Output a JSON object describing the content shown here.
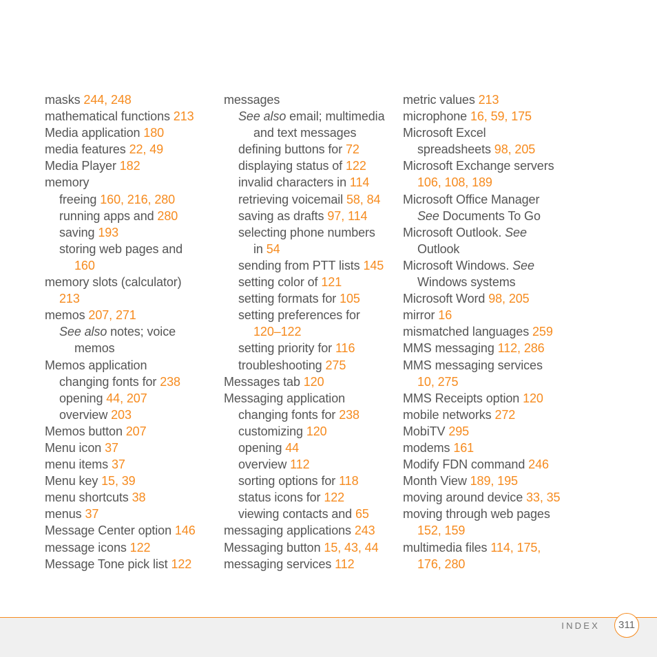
{
  "document": {
    "section_label": "INDEX",
    "page_number": "311",
    "colors": {
      "accent": "#f68b1f",
      "text": "#555555",
      "footer_bg": "#f0f0f0"
    }
  },
  "columns": [
    {
      "entries": [
        {
          "level": 0,
          "text": "masks ",
          "pages": "244, 248"
        },
        {
          "level": 0,
          "text": "mathematical functions ",
          "pages": "213"
        },
        {
          "level": 0,
          "text": "Media application ",
          "pages": "180"
        },
        {
          "level": 0,
          "text": "media features ",
          "pages": "22, 49"
        },
        {
          "level": 0,
          "text": "Media Player ",
          "pages": "182"
        },
        {
          "level": 0,
          "text": "memory",
          "pages": ""
        },
        {
          "level": 1,
          "text": "freeing ",
          "pages": "160, 216, 280"
        },
        {
          "level": 1,
          "text": "running apps and ",
          "pages": "280"
        },
        {
          "level": 1,
          "text": "saving ",
          "pages": "193"
        },
        {
          "level": 1,
          "text": "storing web pages and",
          "pages": ""
        },
        {
          "level": 2,
          "text": "",
          "pages": "160"
        },
        {
          "level": 0,
          "text": "memory slots (calculator)",
          "pages": ""
        },
        {
          "level": 1,
          "text": "",
          "pages": "213"
        },
        {
          "level": 0,
          "text": "memos ",
          "pages": "207, 271"
        },
        {
          "level": 1,
          "italic": "See also",
          "text": " notes; voice",
          "pages": ""
        },
        {
          "level": 2,
          "text": "memos",
          "pages": ""
        },
        {
          "level": 0,
          "text": "Memos application",
          "pages": ""
        },
        {
          "level": 1,
          "text": "changing fonts for ",
          "pages": "238"
        },
        {
          "level": 1,
          "text": "opening ",
          "pages": "44, 207"
        },
        {
          "level": 1,
          "text": "overview ",
          "pages": "203"
        },
        {
          "level": 0,
          "text": "Memos button ",
          "pages": "207"
        },
        {
          "level": 0,
          "text": "Menu icon ",
          "pages": "37"
        },
        {
          "level": 0,
          "text": "menu items ",
          "pages": "37"
        },
        {
          "level": 0,
          "text": "Menu key ",
          "pages": "15, 39"
        },
        {
          "level": 0,
          "text": "menu shortcuts ",
          "pages": "38"
        },
        {
          "level": 0,
          "text": "menus ",
          "pages": "37"
        },
        {
          "level": 0,
          "text": "Message Center option ",
          "pages": "146"
        },
        {
          "level": 0,
          "text": "message icons ",
          "pages": "122"
        },
        {
          "level": 0,
          "text": "Message Tone pick list ",
          "pages": "122"
        }
      ]
    },
    {
      "entries": [
        {
          "level": 0,
          "text": "messages",
          "pages": ""
        },
        {
          "level": 1,
          "italic": "See also",
          "text": " email; multimedia",
          "pages": ""
        },
        {
          "level": 2,
          "text": "and text messages",
          "pages": ""
        },
        {
          "level": 1,
          "text": "defining buttons for ",
          "pages": "72"
        },
        {
          "level": 1,
          "text": "displaying status of ",
          "pages": "122"
        },
        {
          "level": 1,
          "text": "invalid characters in ",
          "pages": "114"
        },
        {
          "level": 1,
          "text": "retrieving voicemail ",
          "pages": "58, 84"
        },
        {
          "level": 1,
          "text": "saving as drafts ",
          "pages": "97, 114"
        },
        {
          "level": 1,
          "text": "selecting phone numbers",
          "pages": ""
        },
        {
          "level": 2,
          "text": "in ",
          "pages": "54"
        },
        {
          "level": 1,
          "text": "sending from PTT lists ",
          "pages": "145"
        },
        {
          "level": 1,
          "text": "setting color of ",
          "pages": "121"
        },
        {
          "level": 1,
          "text": "setting formats for ",
          "pages": "105"
        },
        {
          "level": 1,
          "text": "setting preferences for",
          "pages": ""
        },
        {
          "level": 2,
          "text": "",
          "pages": "120–122"
        },
        {
          "level": 1,
          "text": "setting priority for ",
          "pages": "116"
        },
        {
          "level": 1,
          "text": "troubleshooting ",
          "pages": "275"
        },
        {
          "level": 0,
          "text": "Messages tab ",
          "pages": "120"
        },
        {
          "level": 0,
          "text": "Messaging application",
          "pages": ""
        },
        {
          "level": 1,
          "text": "changing fonts for ",
          "pages": "238"
        },
        {
          "level": 1,
          "text": "customizing ",
          "pages": "120"
        },
        {
          "level": 1,
          "text": "opening ",
          "pages": "44"
        },
        {
          "level": 1,
          "text": "overview ",
          "pages": "112"
        },
        {
          "level": 1,
          "text": "sorting options for ",
          "pages": "118"
        },
        {
          "level": 1,
          "text": "status icons for ",
          "pages": "122"
        },
        {
          "level": 1,
          "text": "viewing contacts and ",
          "pages": "65"
        },
        {
          "level": 0,
          "text": "messaging applications ",
          "pages": "243"
        },
        {
          "level": 0,
          "text": "Messaging button ",
          "pages": "15, 43, 44"
        },
        {
          "level": 0,
          "text": "messaging services ",
          "pages": "112"
        }
      ]
    },
    {
      "entries": [
        {
          "level": 0,
          "text": "metric values ",
          "pages": "213"
        },
        {
          "level": 0,
          "text": "microphone ",
          "pages": "16, 59, 175"
        },
        {
          "level": 0,
          "text": "Microsoft Excel",
          "pages": ""
        },
        {
          "level": 1,
          "text": "spreadsheets ",
          "pages": "98, 205"
        },
        {
          "level": 0,
          "text": "Microsoft Exchange servers",
          "pages": ""
        },
        {
          "level": 1,
          "text": "",
          "pages": "106, 108, 189"
        },
        {
          "level": 0,
          "text": "Microsoft Office Manager",
          "pages": ""
        },
        {
          "level": 1,
          "italic": "See",
          "text": " Documents To Go",
          "pages": ""
        },
        {
          "level": 0,
          "text": "Microsoft Outlook. ",
          "italic_after": "See",
          "pages": ""
        },
        {
          "level": 1,
          "text": "Outlook",
          "pages": ""
        },
        {
          "level": 0,
          "text": "Microsoft Windows. ",
          "italic_after": "See",
          "pages": ""
        },
        {
          "level": 1,
          "text": "Windows systems",
          "pages": ""
        },
        {
          "level": 0,
          "text": "Microsoft Word ",
          "pages": "98, 205"
        },
        {
          "level": 0,
          "text": "mirror ",
          "pages": "16"
        },
        {
          "level": 0,
          "text": "mismatched languages ",
          "pages": "259"
        },
        {
          "level": 0,
          "text": "MMS messaging ",
          "pages": "112, 286"
        },
        {
          "level": 0,
          "text": "MMS messaging services",
          "pages": ""
        },
        {
          "level": 1,
          "text": "",
          "pages": "10, 275"
        },
        {
          "level": 0,
          "text": "MMS Receipts option ",
          "pages": "120"
        },
        {
          "level": 0,
          "text": "mobile networks ",
          "pages": "272"
        },
        {
          "level": 0,
          "text": "MobiTV ",
          "pages": "295"
        },
        {
          "level": 0,
          "text": "modems ",
          "pages": "161"
        },
        {
          "level": 0,
          "text": "Modify FDN command ",
          "pages": "246"
        },
        {
          "level": 0,
          "text": "Month View ",
          "pages": "189, 195"
        },
        {
          "level": 0,
          "text": "moving around device ",
          "pages": "33, 35"
        },
        {
          "level": 0,
          "text": "moving through web pages",
          "pages": ""
        },
        {
          "level": 1,
          "text": "",
          "pages": "152, 159"
        },
        {
          "level": 0,
          "text": "multimedia files ",
          "pages": "114, 175,"
        },
        {
          "level": 1,
          "text": "",
          "pages": "176, 280"
        }
      ]
    }
  ]
}
